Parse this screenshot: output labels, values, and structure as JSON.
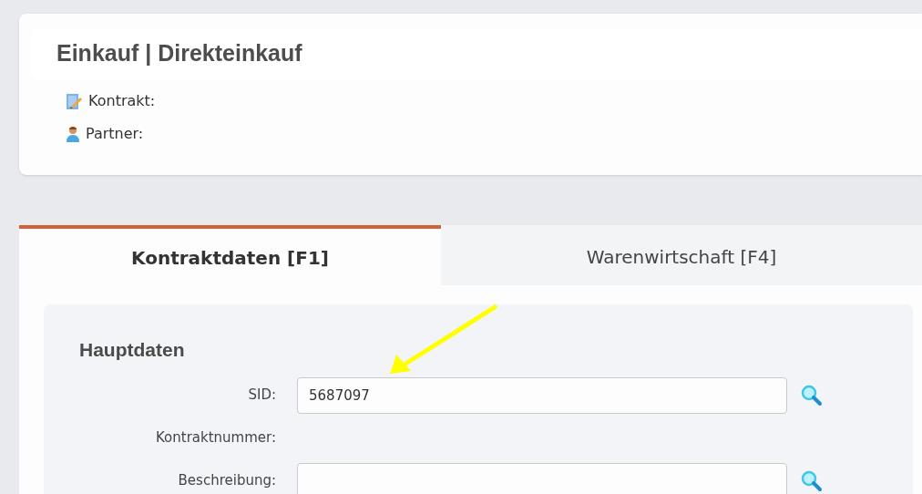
{
  "header": {
    "title": "Einkauf | Direkteinkauf",
    "info": [
      {
        "kind": "contract",
        "label": "Kontrakt:"
      },
      {
        "kind": "person",
        "label": "Partner:"
      }
    ]
  },
  "tabs": [
    {
      "label": "Kontraktdaten [F1]",
      "selected": true
    },
    {
      "label": "Warenwirtschaft [F4]",
      "selected": false
    }
  ],
  "section": {
    "title": "Hauptdaten",
    "fields": [
      {
        "kind": "input",
        "label": "SID:",
        "value": "5687097"
      },
      {
        "kind": "text",
        "label": "Kontraktnummer:"
      },
      {
        "kind": "input",
        "label": "Beschreibung:"
      }
    ]
  }
}
